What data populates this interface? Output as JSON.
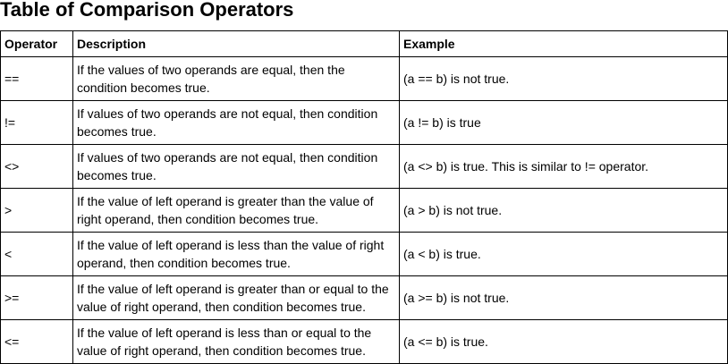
{
  "page_title": "Table of Comparison Operators",
  "table": {
    "headers": [
      "Operator",
      "Description",
      "Example"
    ],
    "rows": [
      {
        "operator": "==",
        "description": "If the values of two operands are equal, then the condition becomes true.",
        "example": "(a == b) is not true."
      },
      {
        "operator": "!=",
        "description": "If values of two operands are not equal, then condition becomes true.",
        "example": "(a != b) is true"
      },
      {
        "operator": "<>",
        "description": "If values of two operands are not equal, then condition becomes true.",
        "example": "(a <> b) is true. This is similar to != operator."
      },
      {
        "operator": ">",
        "description": "If the value of left operand is greater than the value of right operand, then condition becomes true.",
        "example": "(a > b) is not true."
      },
      {
        "operator": "<",
        "description": "If the value of left operand is less than the value of right operand, then condition becomes true.",
        "example": "(a < b) is true."
      },
      {
        "operator": ">=",
        "description": "If the value of left operand is greater than or equal to the value of right operand, then condition becomes true.",
        "example": "(a >= b) is not true."
      },
      {
        "operator": "<=",
        "description": "If the value of left operand is less than or equal to the value of right operand, then condition becomes true.",
        "example": "(a <= b) is true."
      }
    ]
  }
}
